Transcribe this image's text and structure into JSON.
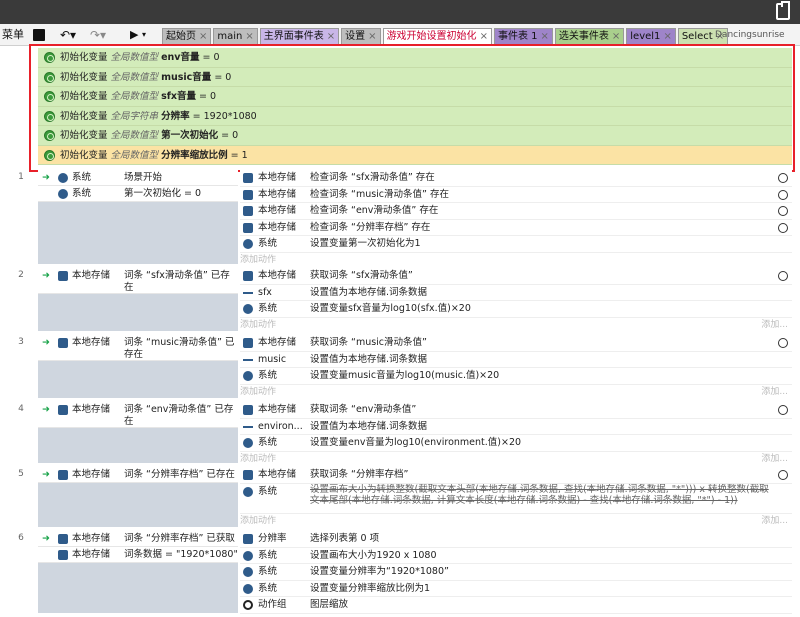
{
  "toolbar": {
    "menu_label": "菜单",
    "save_icon": "save-icon",
    "run_label": "▶"
  },
  "tabs": [
    {
      "label": "起始页",
      "style": "t-gray"
    },
    {
      "label": "main",
      "style": "t-gray"
    },
    {
      "label": "主界面事件表",
      "style": "t-lav"
    },
    {
      "label": "设置",
      "style": "t-gray"
    },
    {
      "label": "游戏开始设置初始化",
      "style": "t-active"
    },
    {
      "label": "事件表 1",
      "style": "t-purple"
    },
    {
      "label": "选关事件表",
      "style": "t-green"
    },
    {
      "label": "level1",
      "style": "t-purple"
    },
    {
      "label": "Select",
      "style": "t-lgreen"
    }
  ],
  "user": "Dancingsunrise",
  "globals": [
    {
      "prefix": "初始化变量",
      "kind": "全局数值型",
      "name": "env音量",
      "value": " = 0"
    },
    {
      "prefix": "初始化变量",
      "kind": "全局数值型",
      "name": "music音量",
      "value": " = 0"
    },
    {
      "prefix": "初始化变量",
      "kind": "全局数值型",
      "name": "sfx音量",
      "value": " = 0"
    },
    {
      "prefix": "初始化变量",
      "kind": "全局字符串",
      "name": "分辨率",
      "value": " = 1920*1080"
    },
    {
      "prefix": "初始化变量",
      "kind": "全局数值型",
      "name": "第一次初始化",
      "value": " = 0"
    },
    {
      "prefix": "初始化变量",
      "kind": "全局数值型",
      "name": "分辨率缩放比例",
      "value": " = 1"
    }
  ],
  "add_action": "添加动作",
  "add_more": "添加...",
  "events": [
    {
      "num": "1",
      "conditions": [
        {
          "obj": "系统",
          "text": "场景开始"
        },
        {
          "obj": "系统",
          "text": "第一次初始化 = 0"
        }
      ],
      "actions": [
        {
          "icon": "ic-store",
          "obj": "本地存储",
          "text": "检查词条 “sfx滑动条值” 存在",
          "clock": true
        },
        {
          "icon": "ic-store",
          "obj": "本地存储",
          "text": "检查词条 “music滑动条值” 存在",
          "clock": true
        },
        {
          "icon": "ic-store",
          "obj": "本地存储",
          "text": "检查词条 “env滑动条值” 存在",
          "clock": true
        },
        {
          "icon": "ic-store",
          "obj": "本地存储",
          "text": "检查词条 “分辨率存档” 存在",
          "clock": true
        },
        {
          "icon": "ic-sys",
          "obj": "系统",
          "text": "设置变量第一次初始化为1",
          "clock": false
        }
      ]
    },
    {
      "num": "2",
      "conditions": [
        {
          "obj": "本地存储",
          "text": "词条 “sfx滑动条值” 已存在"
        }
      ],
      "actions": [
        {
          "icon": "ic-store",
          "obj": "本地存储",
          "text": "获取词条 “sfx滑动条值”",
          "clock": true
        },
        {
          "icon": "ic-var",
          "obj": "sfx",
          "text": "设置值为本地存储.词条数据",
          "clock": false
        },
        {
          "icon": "ic-sys",
          "obj": "系统",
          "text": "设置变量sfx音量为log10(sfx.值)×20",
          "clock": false
        }
      ]
    },
    {
      "num": "3",
      "conditions": [
        {
          "obj": "本地存储",
          "text": "词条 “music滑动条值” 已存在"
        }
      ],
      "actions": [
        {
          "icon": "ic-store",
          "obj": "本地存储",
          "text": "获取词条 “music滑动条值”",
          "clock": true
        },
        {
          "icon": "ic-var",
          "obj": "music",
          "text": "设置值为本地存储.词条数据",
          "clock": false
        },
        {
          "icon": "ic-sys",
          "obj": "系统",
          "text": "设置变量music音量为log10(music.值)×20",
          "clock": false
        }
      ]
    },
    {
      "num": "4",
      "conditions": [
        {
          "obj": "本地存储",
          "text": "词条 “env滑动条值” 已存在"
        }
      ],
      "actions": [
        {
          "icon": "ic-store",
          "obj": "本地存储",
          "text": "获取词条 “env滑动条值”",
          "clock": true
        },
        {
          "icon": "ic-var",
          "obj": "environ...",
          "text": "设置值为本地存储.词条数据",
          "clock": false
        },
        {
          "icon": "ic-sys",
          "obj": "系统",
          "text": "设置变量env音量为log10(environment.值)×20",
          "clock": false
        }
      ]
    },
    {
      "num": "5",
      "conditions": [
        {
          "obj": "本地存储",
          "text": "词条 “分辨率存档” 已存在"
        }
      ],
      "actions": [
        {
          "icon": "ic-store",
          "obj": "本地存储",
          "text": "获取词条 “分辨率存档”",
          "clock": true
        },
        {
          "icon": "ic-sys",
          "obj": "系统",
          "text": "设置画布大小为转换整数(截取文本头部(本地存储.词条数据, 查找(本地存储.词条数据, \"*\"))) x 转换整数(截取文本尾部(本地存储.词条数据, 计算文本长度(本地存储.词条数据) - 查找(本地存储.词条数据, \"*\") - 1))",
          "clock": false,
          "strike": true
        }
      ]
    },
    {
      "num": "6",
      "conditions": [
        {
          "obj": "本地存储",
          "text": "词条 “分辨率存档” 已获取"
        },
        {
          "obj": "本地存储",
          "text": "词条数据 = \"1920*1080\""
        }
      ],
      "actions": [
        {
          "icon": "ic-store",
          "obj": "分辨率",
          "text": "选择列表第 0 项",
          "clock": false
        },
        {
          "icon": "ic-sys",
          "obj": "系统",
          "text": "设置画布大小为1920 x 1080",
          "clock": false
        },
        {
          "icon": "ic-sys",
          "obj": "系统",
          "text": "设置变量分辨率为“1920*1080”",
          "clock": false
        },
        {
          "icon": "ic-sys",
          "obj": "系统",
          "text": "设置变量分辨率缩放比例为1",
          "clock": false
        },
        {
          "icon": "ic-grp",
          "obj": "动作组",
          "text": "图层缩放",
          "clock": false
        }
      ]
    }
  ]
}
